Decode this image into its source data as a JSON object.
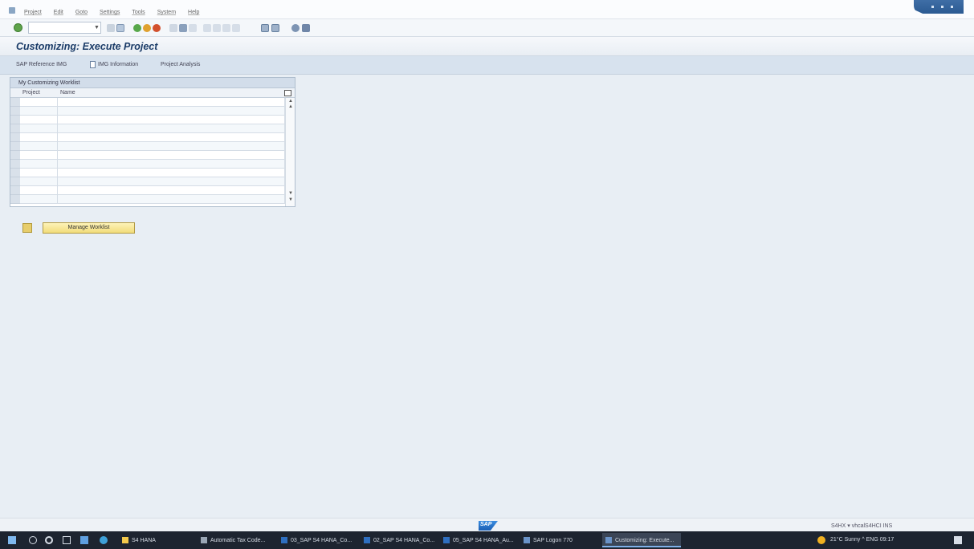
{
  "menu": {
    "items": [
      "Project",
      "Edit",
      "Goto",
      "Settings",
      "Tools",
      "System",
      "Help"
    ]
  },
  "toolbar": {
    "command_field": {
      "value": "",
      "placeholder": ""
    }
  },
  "title": "Customizing: Execute Project",
  "app_toolbar": {
    "buttons": [
      "SAP Reference IMG",
      "IMG Information",
      "Project Analysis"
    ]
  },
  "panel": {
    "title": "My Customizing Worklist",
    "columns": [
      "Project",
      "Name"
    ],
    "rows": [
      [
        "",
        ""
      ],
      [
        "",
        ""
      ],
      [
        "",
        ""
      ],
      [
        "",
        ""
      ],
      [
        "",
        ""
      ],
      [
        "",
        ""
      ],
      [
        "",
        ""
      ],
      [
        "",
        ""
      ],
      [
        "",
        ""
      ],
      [
        "",
        ""
      ],
      [
        "",
        ""
      ],
      [
        "",
        ""
      ]
    ]
  },
  "manage_button": {
    "label": "Manage Worklist"
  },
  "footer": {
    "logo": "SAP",
    "status": "S4HX ▾  vhcalS4HCI  INS"
  },
  "taskbar": {
    "apps": [
      {
        "label": "S4 HANA"
      },
      {
        "label": "Automatic Tax Code..."
      },
      {
        "label": "03_SAP S4 HANA_Co..."
      },
      {
        "label": "02_SAP S4 HANA_Co..."
      },
      {
        "label": "05_SAP S4 HANA_Au..."
      },
      {
        "label": "SAP Logon 770"
      },
      {
        "label": "Customizing: Execute..."
      }
    ],
    "tray": "21°C Sunny  ^  ENG  09:17"
  },
  "colors": {
    "title_text": "#1b3c68",
    "app_toolbar_bg": "#d7e2ee",
    "manage_button_bg": "#f2dc7a",
    "taskbar_bg": "#1d2430"
  }
}
